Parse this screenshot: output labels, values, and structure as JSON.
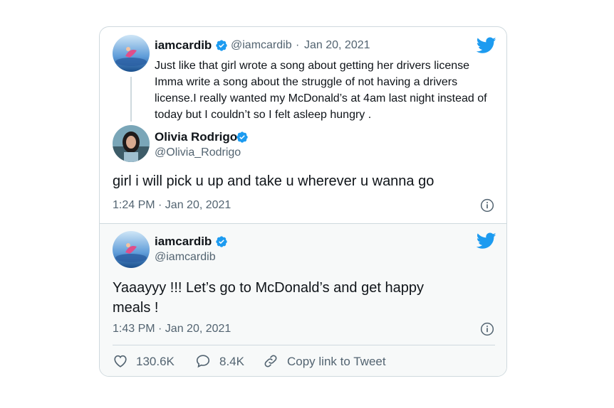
{
  "quoted_tweet": {
    "author_name": "iamcardib",
    "handle": "@iamcardib",
    "separator": "·",
    "date": "Jan 20, 2021",
    "text": "Just like that girl wrote a song about getting her drivers license Imma write a song about the struggle of not having a drivers license.I really wanted my McDonald’s at 4am last night instead of today but I couldn’t so I felt asleep hungry ."
  },
  "reply_tweet": {
    "author_name": "Olivia Rodrigo",
    "handle": "@Olivia_Rodrigo",
    "text": "girl i will pick u up and take u wherever u wanna go",
    "timestamp": "1:24 PM · Jan 20, 2021"
  },
  "main_tweet": {
    "author_name": "iamcardib",
    "handle": "@iamcardib",
    "text": "Yaaayyy !!! Let’s go to McDonald’s and get happy meals !",
    "timestamp": "1:43 PM · Jan 20, 2021",
    "actions": {
      "likes": "130.6K",
      "replies": "8.4K",
      "copy_link": "Copy link to Tweet"
    }
  },
  "icons": {
    "logo": "twitter-bird-icon",
    "verified": "verified-badge-icon",
    "info": "info-icon",
    "like": "heart-icon",
    "reply": "speech-bubble-icon",
    "link": "link-icon"
  },
  "colors": {
    "brand_blue": "#1d9bf0",
    "text_primary": "#0f1419",
    "text_secondary": "#536471",
    "border": "#cfd9de",
    "lower_background": "#f7f9f9"
  }
}
